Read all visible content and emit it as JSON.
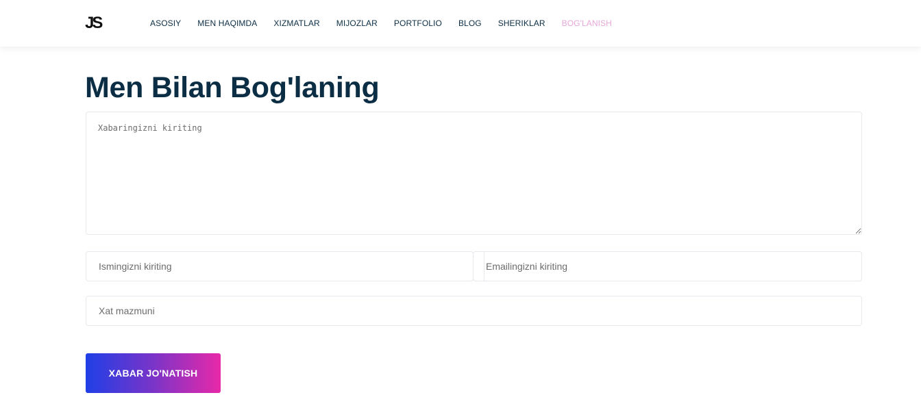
{
  "header": {
    "logo_text": "JS",
    "nav": [
      {
        "label": "ASOSIY"
      },
      {
        "label": "MEN HAQIMDA"
      },
      {
        "label": "XIZMATLAR"
      },
      {
        "label": "MIJOZLAR"
      },
      {
        "label": "PORTFOLIO"
      },
      {
        "label": "BLOG"
      },
      {
        "label": "SHERIKLAR"
      },
      {
        "label": "BOG'LANISH",
        "active": true
      }
    ],
    "active_color": "#e8a7d8"
  },
  "contact": {
    "title": "Men Bilan Bog'laning",
    "message_placeholder": "Xabaringizni kiriting",
    "name_placeholder": "Ismingizni kiriting",
    "email_placeholder": "Emailingizni kiriting",
    "subject_placeholder": "Xat mazmuni",
    "submit_label": "XABAR JO'NATISH"
  },
  "colors": {
    "heading": "#0b2e45",
    "button_gradient": [
      "#1f3fe6",
      "#7a34c8",
      "#e829a8"
    ]
  }
}
